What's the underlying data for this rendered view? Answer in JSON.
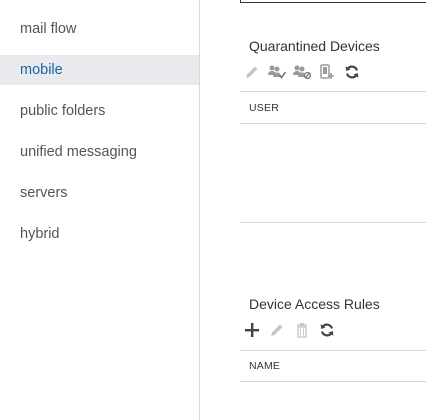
{
  "sidebar": {
    "items": [
      {
        "label": "mail flow",
        "selected": false
      },
      {
        "label": "mobile",
        "selected": true
      },
      {
        "label": "public folders",
        "selected": false
      },
      {
        "label": "unified messaging",
        "selected": false
      },
      {
        "label": "servers",
        "selected": false
      },
      {
        "label": "hybrid",
        "selected": false
      }
    ]
  },
  "quarantined": {
    "title": "Quarantined Devices",
    "toolbar": [
      "edit-icon",
      "allow-users-icon",
      "block-users-icon",
      "device-details-icon",
      "refresh-icon"
    ],
    "column_header": "USER"
  },
  "access_rules": {
    "title": "Device Access Rules",
    "toolbar": [
      "add-icon",
      "edit-icon",
      "delete-icon",
      "refresh-icon"
    ],
    "column_header": "NAME"
  },
  "colors": {
    "selected_text": "#1565a8",
    "selected_bg": "#e8eaed",
    "icon_disabled": "#b0b0b0",
    "icon_active": "#444444"
  }
}
